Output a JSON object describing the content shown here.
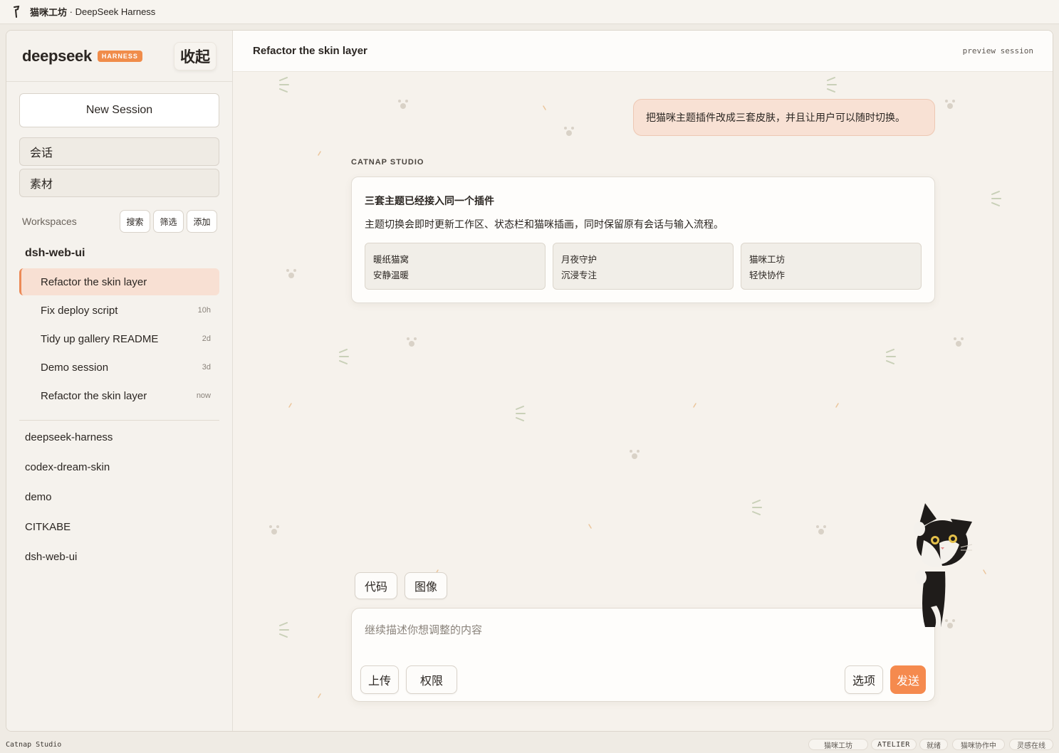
{
  "titlebar": {
    "app_name": "猫咪工坊",
    "separator": " · ",
    "subtitle": "DeepSeek Harness"
  },
  "sidebar": {
    "logo": "deepseek",
    "badge": "HARNESS",
    "collapse_label": "收起",
    "new_session_label": "New Session",
    "nav": [
      {
        "label": "会话"
      },
      {
        "label": "素材"
      }
    ],
    "workspaces_label": "Workspaces",
    "workspace_actions": [
      {
        "label": "搜索"
      },
      {
        "label": "筛选"
      },
      {
        "label": "添加"
      }
    ],
    "active_workspace": "dsh-web-ui",
    "sessions": [
      {
        "title": "Refactor the skin layer",
        "age": "",
        "active": true
      },
      {
        "title": "Fix deploy script",
        "age": "10h"
      },
      {
        "title": "Tidy up gallery README",
        "age": "2d"
      },
      {
        "title": "Demo session",
        "age": "3d"
      },
      {
        "title": "Refactor the skin layer",
        "age": "now"
      }
    ],
    "workspaces": [
      {
        "name": "deepseek-harness"
      },
      {
        "name": "codex-dream-skin"
      },
      {
        "name": "demo"
      },
      {
        "name": "CITKABE"
      },
      {
        "name": "dsh-web-ui"
      }
    ]
  },
  "main": {
    "title": "Refactor the skin layer",
    "preview_tag": "preview session",
    "user_message": "把猫咪主题插件改成三套皮肤，并且让用户可以随时切换。",
    "assistant_name": "CATNAP STUDIO",
    "reply": {
      "title": "三套主题已经接入同一个插件",
      "body": "主题切换会即时更新工作区、状态栏和猫咪插画，同时保留原有会话与输入流程。",
      "themes": [
        {
          "name": "暖纸猫窝",
          "desc": "安静温暖"
        },
        {
          "name": "月夜守护",
          "desc": "沉浸专注"
        },
        {
          "name": "猫咪工坊",
          "desc": "轻快协作"
        }
      ]
    },
    "modes": [
      {
        "label": "代码"
      },
      {
        "label": "图像"
      }
    ],
    "composer": {
      "placeholder": "继续描述你想调整的内容",
      "value": "",
      "upload_label": "上传",
      "permissions_label": "权限",
      "options_label": "选项",
      "send_label": "发送"
    }
  },
  "statusbar": {
    "left": "Catnap Studio",
    "pills": [
      {
        "label": "猫咪工坊"
      },
      {
        "label": "ATELIER"
      },
      {
        "label": "就绪"
      },
      {
        "label": "猫咪协作中"
      },
      {
        "label": "灵感在线"
      }
    ]
  },
  "colors": {
    "accent": "#f58a4e",
    "active_session_bg": "#f8e0d3",
    "user_bubble_bg": "#f8e1d4",
    "background": "#f6f2ec"
  }
}
